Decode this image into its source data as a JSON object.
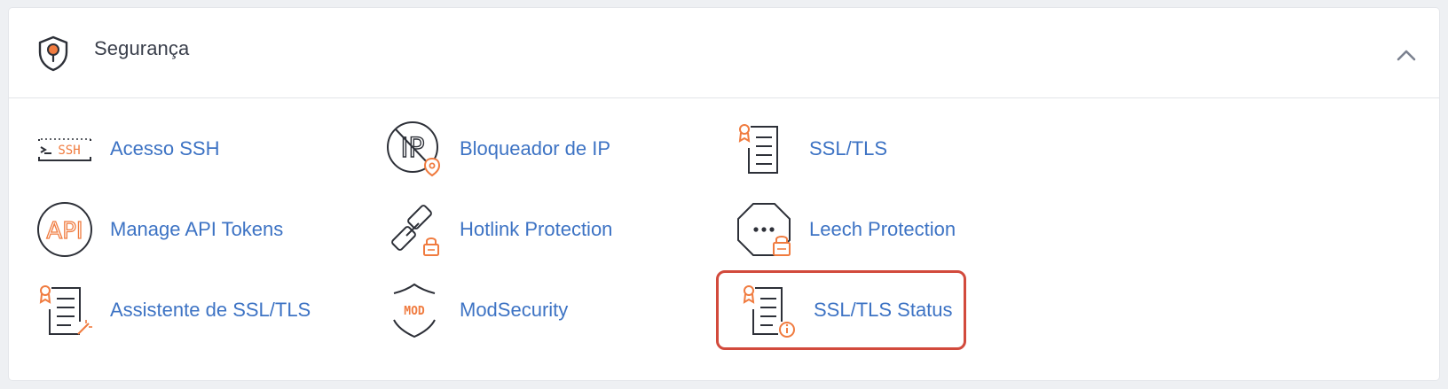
{
  "section": {
    "title": "Segurança",
    "icon": "security-shield-icon",
    "collapse_icon": "chevron-up-icon"
  },
  "items": [
    {
      "label": "Acesso SSH",
      "icon": "ssh-terminal-icon",
      "icon_text": "SSH"
    },
    {
      "label": "Bloqueador de IP",
      "icon": "ip-blocker-icon",
      "icon_text": "IP"
    },
    {
      "label": "SSL/TLS",
      "icon": "ssl-certificate-icon"
    },
    {
      "label": "Manage API Tokens",
      "icon": "api-token-icon",
      "icon_text": "API"
    },
    {
      "label": "Hotlink Protection",
      "icon": "hotlink-protection-icon"
    },
    {
      "label": "Leech Protection",
      "icon": "leech-protection-icon"
    },
    {
      "label": "Assistente de SSL/TLS",
      "icon": "ssl-wizard-icon"
    },
    {
      "label": "ModSecurity",
      "icon": "modsecurity-shield-icon",
      "icon_text": "MOD"
    },
    {
      "label": "SSL/TLS Status",
      "icon": "ssl-status-icon",
      "highlighted": true
    }
  ],
  "colors": {
    "link": "#3d73c4",
    "accent": "#f07b3f",
    "icon_stroke": "#2d3038",
    "highlight_border": "#d24a3c",
    "title": "#3a3f4b"
  }
}
